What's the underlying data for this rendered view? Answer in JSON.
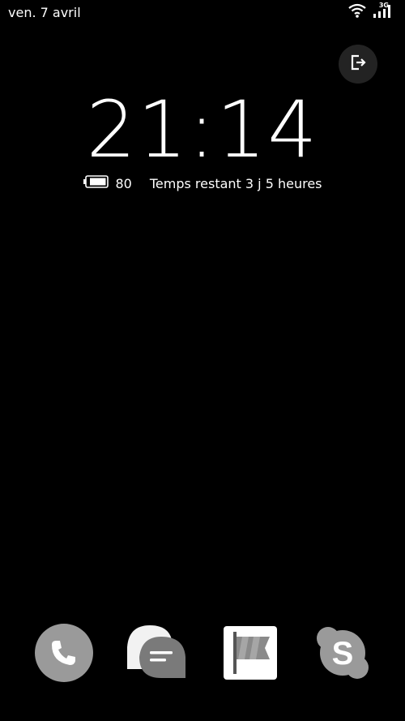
{
  "status_bar": {
    "date": "ven. 7 avril",
    "network_type": "3G",
    "icons": [
      "wifi-icon",
      "signal-icon"
    ]
  },
  "lock_screen": {
    "time": "21:14",
    "battery_level": "80",
    "battery_remaining": "Temps restant 3 j 5 heures",
    "exit_icon": "exit-icon"
  },
  "dock": {
    "apps": [
      "phone-icon",
      "messages-icon",
      "flag-app-icon",
      "skype-icon"
    ]
  },
  "colors": {
    "background": "#000000",
    "text": "#ffffff",
    "icon_gray": "#9a9a9a"
  }
}
